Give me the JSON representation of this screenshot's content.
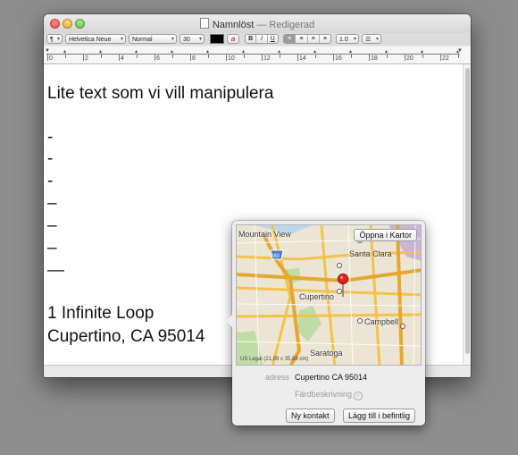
{
  "window": {
    "title": "Namnlöst",
    "title_separator": "—",
    "title_status": "Redigerad"
  },
  "toolbar": {
    "paragraph_style": "¶",
    "font_family": "Helvetica Neue",
    "font_typeface": "Normal",
    "font_size": "30",
    "text_color": "#000000",
    "highlight_button": "a",
    "bold": "B",
    "italic": "I",
    "underline": "U",
    "align_left": "≡",
    "align_center": "≡",
    "align_right": "≡",
    "align_justify": "≡",
    "line_spacing": "1.0",
    "list": "☰"
  },
  "ruler": {
    "labels": [
      "0",
      "2",
      "4",
      "6",
      "8",
      "10",
      "12",
      "14",
      "16",
      "18",
      "20",
      "22"
    ]
  },
  "document": {
    "lines": [
      "Lite text som vi vill manipulera",
      "",
      "-",
      "-",
      "-",
      "–",
      "–",
      "–",
      "—",
      "",
      "1 Infinite Loop",
      "Cupertino, CA 95014"
    ]
  },
  "popover": {
    "open_in_maps": "Öppna i Kartor",
    "map_labels": {
      "mountain_view": "Mountain View",
      "santa_clara": "Santa Clara",
      "cupertino": "Cupertino",
      "campbell": "Campbell",
      "saratoga": "Saratoga",
      "highway_280": "280"
    },
    "map_legal": "US Legal (21,89 x 35,88 cm)",
    "address_label": "adress",
    "address_value": "Cupertino CA 95014",
    "directions": "Färdbeskrivning",
    "new_contact": "Ny kontakt",
    "add_to_existing": "Lägg till i befintlig"
  }
}
